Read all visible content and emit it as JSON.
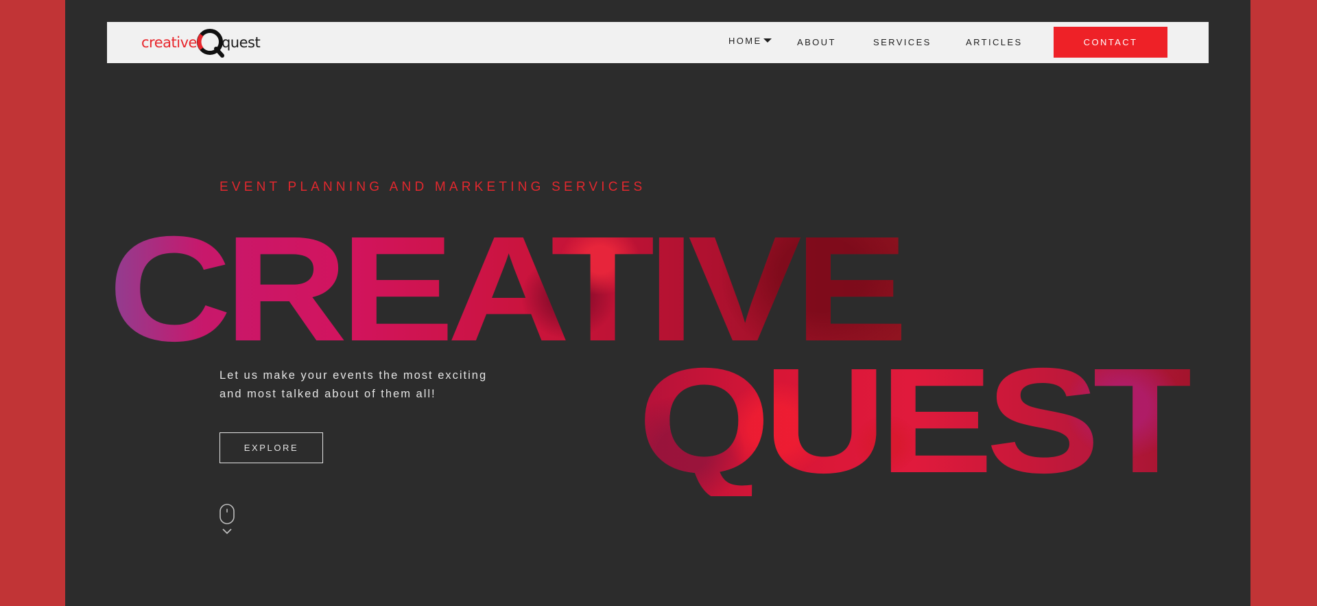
{
  "brand": {
    "logo_part1": "creative",
    "logo_part2": "quest",
    "colors": {
      "accent": "#ee2127",
      "outer_background": "#c13436",
      "page_background": "#2c2c2c",
      "navbar_background": "#f1f1f1"
    }
  },
  "nav": {
    "items": [
      {
        "label": "HOME",
        "has_dropdown": true,
        "icon": "caret-down-icon"
      },
      {
        "label": "ABOUT"
      },
      {
        "label": "SERVICES"
      },
      {
        "label": "ARTICLES"
      }
    ],
    "contact_label": "CONTACT"
  },
  "hero": {
    "eyebrow": "EVENT PLANNING AND MARKETING SERVICES",
    "title_line1": "CREATIVE",
    "title_line2": "QUEST",
    "tagline_line1": "Let us make your events the most exciting",
    "tagline_line2": "and most talked about of them all!",
    "explore_label": "EXPLORE",
    "scroll_icon": "mouse-scroll-icon"
  }
}
